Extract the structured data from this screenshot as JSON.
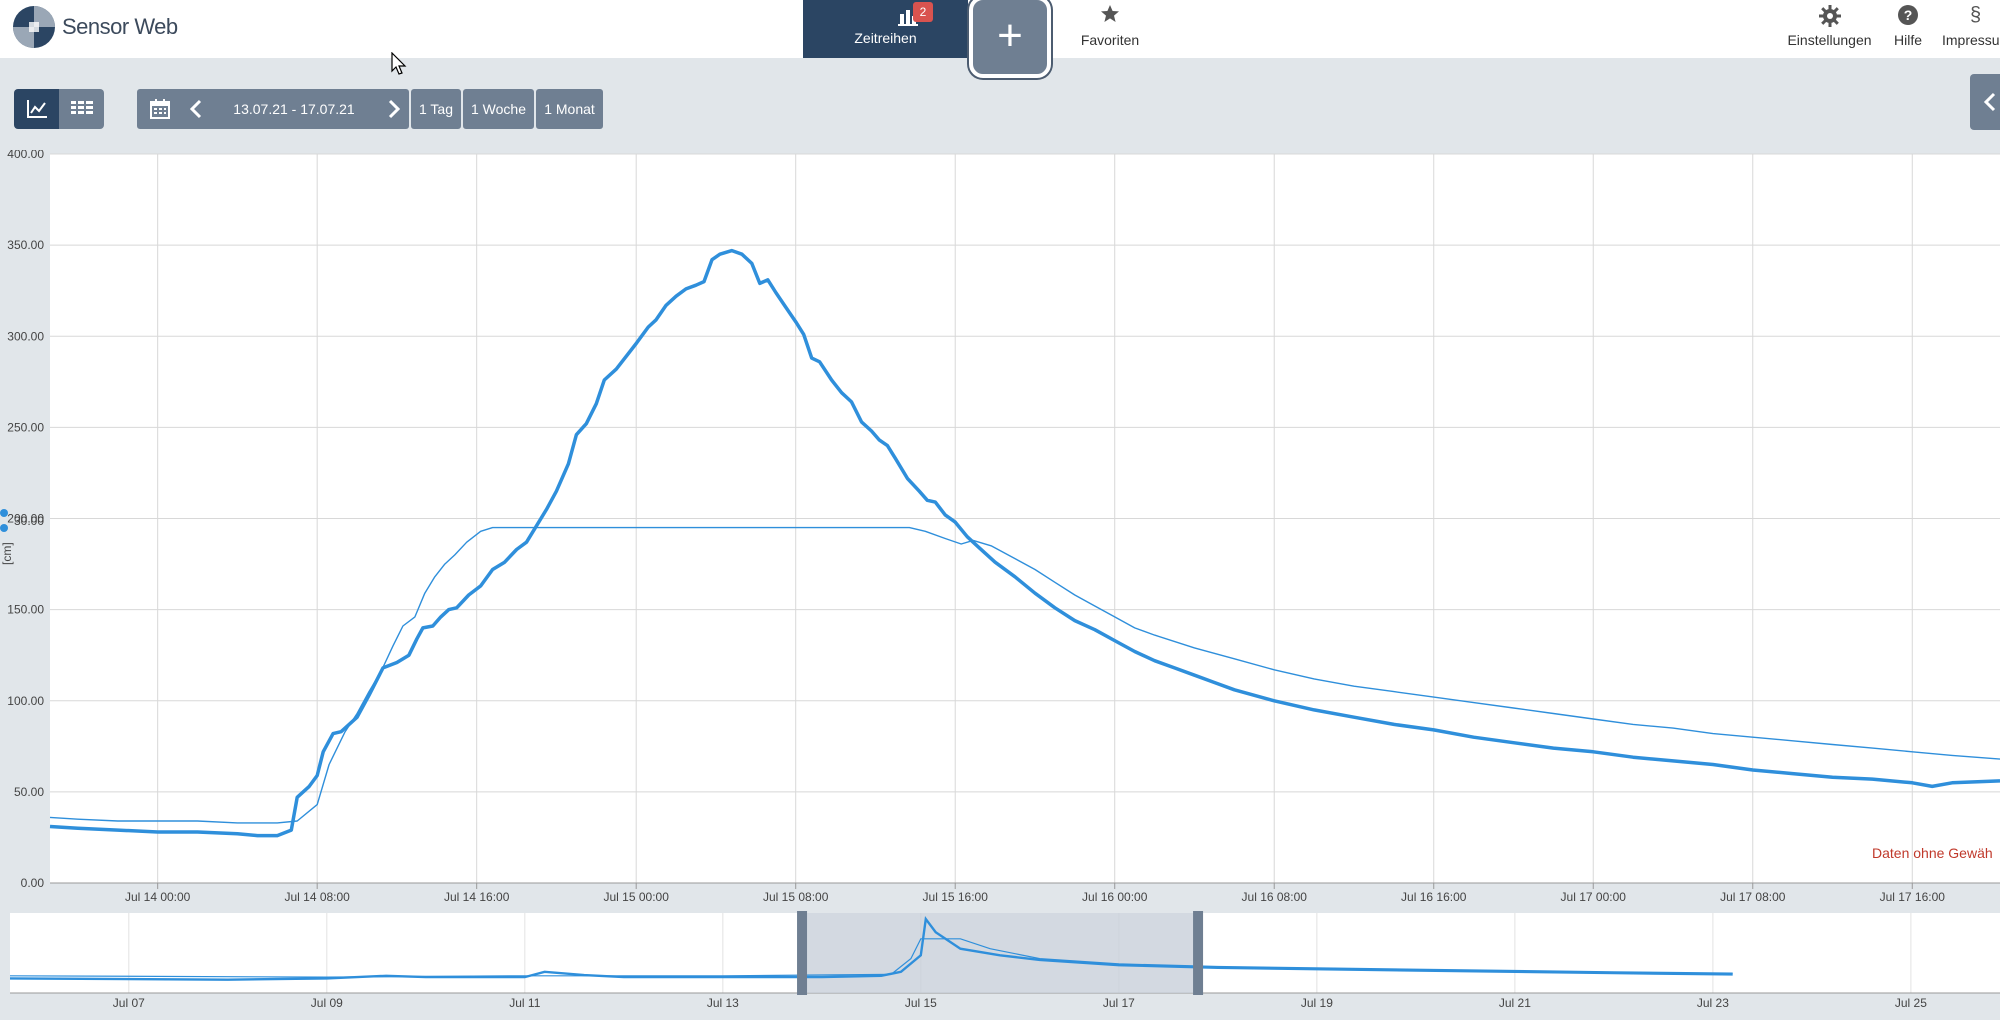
{
  "app": {
    "title": "Sensor Web"
  },
  "nav": {
    "zeitreihen": {
      "label": "Zeitreihen",
      "badge": "2"
    },
    "add": {
      "label": "+"
    },
    "favoriten": {
      "label": "Favoriten"
    },
    "einstellungen": {
      "label": "Einstellungen"
    },
    "hilfe": {
      "label": "Hilfe"
    },
    "impressum": {
      "label": "Impressu"
    }
  },
  "toolbar": {
    "date_range": "13.07.21 - 17.07.21",
    "presets": [
      "1 Tag",
      "1 Woche",
      "1 Monat"
    ]
  },
  "colors": {
    "navbar_active": "#2b4563",
    "button": "#6f7f92",
    "series": "#2f8fdb",
    "background": "#e1e6ea",
    "warning_text": "#c0392b"
  },
  "chart_data": {
    "type": "line",
    "ylim": [
      0,
      400
    ],
    "y_ticks": [
      "0.00",
      "50.00",
      "100.00",
      "150.00",
      "200.00",
      "250.00",
      "300.00",
      "350.00",
      "400.00"
    ],
    "y_tick_values": [
      0,
      50,
      100,
      150,
      200,
      250,
      300,
      350,
      400
    ],
    "ylabel": "[cm]",
    "y_tick_partial": "30.00",
    "x_ticks": [
      "Jul 14 00:00",
      "Jul 14 08:00",
      "Jul 14 16:00",
      "Jul 15 00:00",
      "Jul 15 08:00",
      "Jul 15 16:00",
      "Jul 16 00:00",
      "Jul 16 08:00",
      "Jul 16 16:00",
      "Jul 17 00:00",
      "Jul 17 08:00",
      "Jul 17 16:00"
    ],
    "x_tick_hours": [
      24,
      32,
      40,
      48,
      56,
      64,
      72,
      80,
      88,
      96,
      104,
      112
    ],
    "x_range_hours": [
      18.6,
      116.4
    ],
    "grid": true,
    "annotation": "Daten ohne Gewäh",
    "series": [
      {
        "style": "thick",
        "points": [
          [
            18.6,
            31
          ],
          [
            20,
            30
          ],
          [
            22,
            29
          ],
          [
            24,
            28
          ],
          [
            26,
            28
          ],
          [
            28,
            27
          ],
          [
            29,
            26
          ],
          [
            30,
            26
          ],
          [
            30.7,
            29
          ],
          [
            31,
            47
          ],
          [
            31.6,
            53
          ],
          [
            32,
            59
          ],
          [
            32.3,
            72
          ],
          [
            32.8,
            82
          ],
          [
            33.2,
            83
          ],
          [
            34,
            91
          ],
          [
            34.6,
            103
          ],
          [
            35.3,
            118
          ],
          [
            36,
            121
          ],
          [
            36.6,
            125
          ],
          [
            37,
            134
          ],
          [
            37.3,
            140
          ],
          [
            37.8,
            141
          ],
          [
            38.2,
            146
          ],
          [
            38.6,
            150
          ],
          [
            39,
            151
          ],
          [
            39.6,
            158
          ],
          [
            40.2,
            163
          ],
          [
            40.8,
            172
          ],
          [
            41.4,
            176
          ],
          [
            42,
            183
          ],
          [
            42.5,
            187
          ],
          [
            43,
            196
          ],
          [
            43.5,
            205
          ],
          [
            44,
            215
          ],
          [
            44.6,
            230
          ],
          [
            45,
            246
          ],
          [
            45.5,
            252
          ],
          [
            46,
            263
          ],
          [
            46.4,
            276
          ],
          [
            47,
            282
          ],
          [
            48,
            296
          ],
          [
            48.6,
            305
          ],
          [
            49,
            309
          ],
          [
            49.5,
            317
          ],
          [
            50,
            322
          ],
          [
            50.5,
            326
          ],
          [
            51,
            328
          ],
          [
            51.4,
            330
          ],
          [
            51.8,
            342
          ],
          [
            52.2,
            345
          ],
          [
            52.8,
            347
          ],
          [
            53.3,
            345
          ],
          [
            53.8,
            340
          ],
          [
            54.2,
            329
          ],
          [
            54.6,
            331
          ],
          [
            55,
            324
          ],
          [
            55.5,
            316
          ],
          [
            56,
            308
          ],
          [
            56.4,
            301
          ],
          [
            56.8,
            288
          ],
          [
            57.2,
            286
          ],
          [
            57.8,
            276
          ],
          [
            58.3,
            269
          ],
          [
            58.8,
            264
          ],
          [
            59.3,
            253
          ],
          [
            59.8,
            248
          ],
          [
            60.2,
            243
          ],
          [
            60.6,
            240
          ],
          [
            61,
            233
          ],
          [
            61.6,
            222
          ],
          [
            62.2,
            215
          ],
          [
            62.6,
            210
          ],
          [
            63,
            209
          ],
          [
            63.5,
            202
          ],
          [
            64,
            198
          ],
          [
            64.6,
            190
          ],
          [
            65.2,
            184
          ],
          [
            66,
            176
          ],
          [
            67,
            168
          ],
          [
            68,
            159
          ],
          [
            69,
            151
          ],
          [
            70,
            144
          ],
          [
            71,
            139
          ],
          [
            72,
            133
          ],
          [
            73,
            127
          ],
          [
            74,
            122
          ],
          [
            75,
            118
          ],
          [
            76,
            114
          ],
          [
            77,
            110
          ],
          [
            78,
            106
          ],
          [
            79,
            103
          ],
          [
            80,
            100
          ],
          [
            82,
            95
          ],
          [
            84,
            91
          ],
          [
            86,
            87
          ],
          [
            88,
            84
          ],
          [
            90,
            80
          ],
          [
            92,
            77
          ],
          [
            94,
            74
          ],
          [
            96,
            72
          ],
          [
            98,
            69
          ],
          [
            100,
            67
          ],
          [
            102,
            65
          ],
          [
            104,
            62
          ],
          [
            106,
            60
          ],
          [
            108,
            58
          ],
          [
            110,
            57
          ],
          [
            112,
            55
          ],
          [
            113,
            53
          ],
          [
            114,
            55
          ],
          [
            116.4,
            56
          ]
        ]
      },
      {
        "style": "thin",
        "points": [
          [
            18.6,
            36
          ],
          [
            20,
            35
          ],
          [
            22,
            34
          ],
          [
            24,
            34
          ],
          [
            26,
            34
          ],
          [
            28,
            33
          ],
          [
            30,
            33
          ],
          [
            31,
            34
          ],
          [
            32,
            43
          ],
          [
            32.6,
            65
          ],
          [
            33.4,
            83
          ],
          [
            34,
            93
          ],
          [
            34.6,
            105
          ],
          [
            35.2,
            116
          ],
          [
            35.8,
            130
          ],
          [
            36.3,
            141
          ],
          [
            36.9,
            146
          ],
          [
            37.4,
            159
          ],
          [
            37.9,
            168
          ],
          [
            38.4,
            175
          ],
          [
            38.9,
            180
          ],
          [
            39.5,
            187
          ],
          [
            40.2,
            193
          ],
          [
            40.8,
            195
          ],
          [
            41.5,
            195
          ],
          [
            42.5,
            195
          ],
          [
            44,
            195
          ],
          [
            46,
            195
          ],
          [
            50,
            195
          ],
          [
            54,
            195
          ],
          [
            58,
            195
          ],
          [
            60,
            195
          ],
          [
            61.7,
            195
          ],
          [
            62.5,
            193
          ],
          [
            63.5,
            189
          ],
          [
            64.3,
            186
          ],
          [
            64.9,
            188
          ],
          [
            65.8,
            185
          ],
          [
            67,
            178
          ],
          [
            68,
            172
          ],
          [
            69,
            165
          ],
          [
            70,
            158
          ],
          [
            71,
            152
          ],
          [
            72,
            146
          ],
          [
            73,
            140
          ],
          [
            74,
            136
          ],
          [
            76,
            129
          ],
          [
            78,
            123
          ],
          [
            80,
            117
          ],
          [
            82,
            112
          ],
          [
            84,
            108
          ],
          [
            86,
            105
          ],
          [
            88,
            102
          ],
          [
            90,
            99
          ],
          [
            92,
            96
          ],
          [
            94,
            93
          ],
          [
            96,
            90
          ],
          [
            98,
            87
          ],
          [
            100,
            85
          ],
          [
            102,
            82
          ],
          [
            104,
            80
          ],
          [
            106,
            78
          ],
          [
            108,
            76
          ],
          [
            110,
            74
          ],
          [
            112,
            72
          ],
          [
            114,
            70
          ],
          [
            116.4,
            68
          ]
        ]
      }
    ],
    "overview": {
      "x_ticks": [
        "Jul 07",
        "Jul 09",
        "Jul 11",
        "Jul 13",
        "Jul 15",
        "Jul 17",
        "Jul 19",
        "Jul 21",
        "Jul 23",
        "Jul 25"
      ],
      "x_tick_days": [
        7,
        9,
        11,
        13,
        15,
        17,
        19,
        21,
        23,
        25
      ],
      "x_range_days": [
        5.8,
        25.9
      ],
      "selection_days": [
        13.8,
        17.8
      ],
      "thick_points": [
        [
          5.8,
          10
        ],
        [
          8,
          8
        ],
        [
          9,
          10
        ],
        [
          9.6,
          14
        ],
        [
          10,
          12
        ],
        [
          11,
          12
        ],
        [
          11.2,
          20
        ],
        [
          11.6,
          15
        ],
        [
          12,
          12
        ],
        [
          13,
          12
        ],
        [
          14,
          12
        ],
        [
          14.6,
          14
        ],
        [
          14.8,
          20
        ],
        [
          15,
          45
        ],
        [
          15.05,
          100
        ],
        [
          15.15,
          80
        ],
        [
          15.4,
          55
        ],
        [
          15.8,
          45
        ],
        [
          16.2,
          38
        ],
        [
          17,
          30
        ],
        [
          18,
          26
        ],
        [
          20,
          22
        ],
        [
          22,
          18
        ],
        [
          23.2,
          16
        ]
      ],
      "thin_points": [
        [
          5.8,
          14
        ],
        [
          9,
          12
        ],
        [
          11,
          14
        ],
        [
          13,
          14
        ],
        [
          14.7,
          16
        ],
        [
          14.9,
          40
        ],
        [
          15,
          70
        ],
        [
          15.15,
          70
        ],
        [
          15.4,
          70
        ],
        [
          15.7,
          55
        ],
        [
          16.2,
          40
        ],
        [
          17,
          32
        ],
        [
          18,
          28
        ],
        [
          20,
          24
        ],
        [
          22,
          20
        ],
        [
          23.2,
          18
        ]
      ]
    }
  }
}
